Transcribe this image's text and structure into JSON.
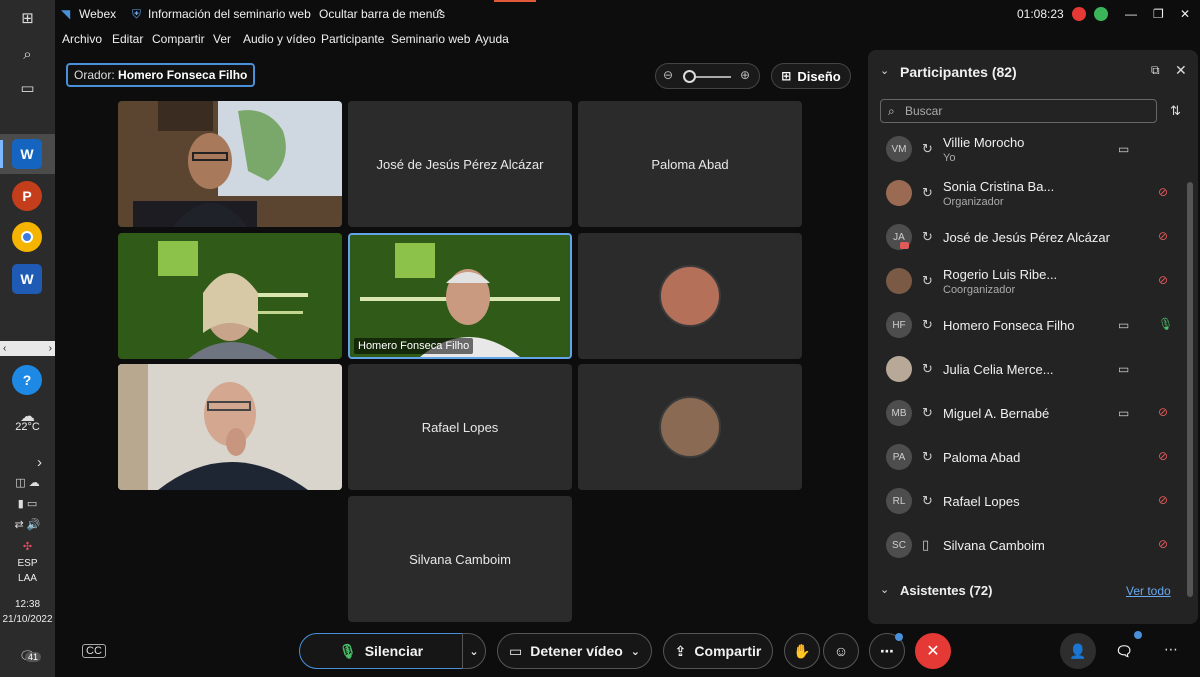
{
  "window": {
    "app_name": "Webex",
    "webinar_info": "Información del seminario web",
    "hide_menu": "Ocultar barra de menús",
    "time": "01:08:23"
  },
  "menu": [
    "Archivo",
    "Editar",
    "Compartir",
    "Ver",
    "Audio y vídeo",
    "Participante",
    "Seminario web",
    "Ayuda"
  ],
  "stage": {
    "speaker_label": "Orador:",
    "speaker_name": "Homero Fonseca Filho",
    "layout_label": "Diseño"
  },
  "tiles": [
    {
      "name": "",
      "kind": "video"
    },
    {
      "name": "José de Jesús Pérez Alcázar",
      "kind": "name"
    },
    {
      "name": "Paloma Abad",
      "kind": "name"
    },
    {
      "name": "",
      "kind": "video-inde"
    },
    {
      "name": "Homero Fonseca Filho",
      "kind": "video-inde-active"
    },
    {
      "name": "",
      "kind": "avatar"
    },
    {
      "name": "",
      "kind": "video"
    },
    {
      "name": "Rafael Lopes",
      "kind": "name"
    },
    {
      "name": "",
      "kind": "avatar"
    },
    {
      "name": "Silvana Camboim",
      "kind": "name"
    }
  ],
  "panel": {
    "title": "Participantes (82)",
    "search_placeholder": "Buscar",
    "attendees": "Asistentes (72)",
    "see_all": "Ver todo",
    "participants": [
      {
        "initials": "VM",
        "name": "Villie Morocho",
        "role": "Yo",
        "cam": true,
        "mic": "none"
      },
      {
        "initials": "",
        "name": "Sonia Cristina Ba...",
        "role": "Organizador",
        "cam": false,
        "mic": "muted"
      },
      {
        "initials": "JA",
        "name": "José de Jesús Pérez Alcázar",
        "role": "",
        "cam": false,
        "mic": "muted"
      },
      {
        "initials": "",
        "name": "Rogerio Luis Ribe...",
        "role": "Coorganizador",
        "cam": false,
        "mic": "muted"
      },
      {
        "initials": "HF",
        "name": "Homero Fonseca Filho",
        "role": "",
        "cam": true,
        "mic": "on"
      },
      {
        "initials": "",
        "name": "Julia Celia Merce...",
        "role": "",
        "cam": true,
        "mic": "none"
      },
      {
        "initials": "MB",
        "name": "Miguel A. Bernabé",
        "role": "",
        "cam": true,
        "mic": "muted"
      },
      {
        "initials": "PA",
        "name": "Paloma Abad",
        "role": "",
        "cam": false,
        "mic": "muted"
      },
      {
        "initials": "RL",
        "name": "Rafael Lopes",
        "role": "",
        "cam": false,
        "mic": "muted"
      },
      {
        "initials": "SC",
        "name": "Silvana Camboim",
        "role": "",
        "cam": false,
        "mic": "muted"
      }
    ]
  },
  "controls": {
    "mute": "Silenciar",
    "stop_video": "Detener vídeo",
    "share": "Compartir"
  },
  "taskbar": {
    "temperature": "22°C",
    "language": "ESP",
    "layout": "LAA",
    "clock": "12:38",
    "date": "21/10/2022",
    "notifications": "41"
  },
  "colors": {
    "accent": "#4a90d9",
    "muted": "#e05a5a",
    "mic_on": "#4cbf6a",
    "leave": "#e53935"
  }
}
